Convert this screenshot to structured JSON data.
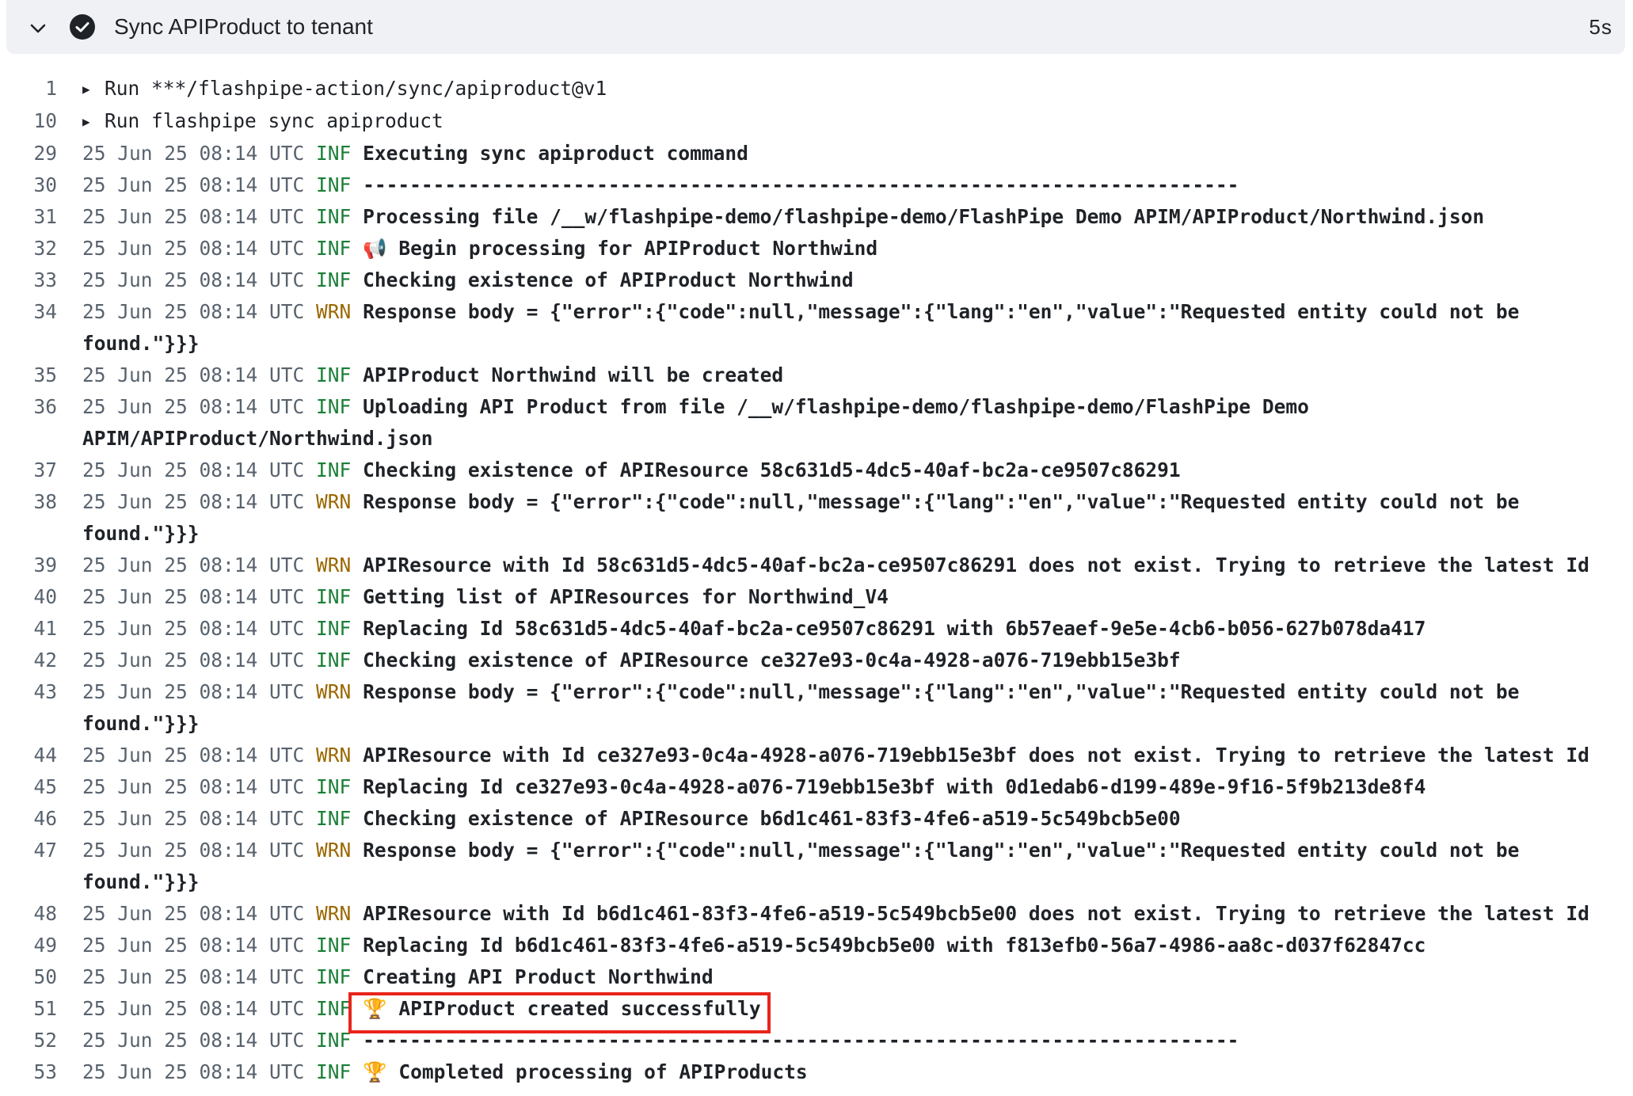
{
  "header": {
    "title": "Sync APIProduct to tenant",
    "duration": "5s",
    "expand_icon": "chevron-down-icon",
    "status_icon": "check-circle-icon"
  },
  "log_lines": [
    {
      "num": "1",
      "type": "run",
      "text": "Run ***/flashpipe-action/sync/apiproduct@v1"
    },
    {
      "num": "10",
      "type": "run",
      "text": "Run flashpipe sync apiproduct"
    },
    {
      "num": "29",
      "ts": "25 Jun 25 08:14 UTC",
      "level": "INF",
      "msg": "Executing sync apiproduct command"
    },
    {
      "num": "30",
      "ts": "25 Jun 25 08:14 UTC",
      "level": "INF",
      "msg": "---------------------------------------------------------------------------"
    },
    {
      "num": "31",
      "ts": "25 Jun 25 08:14 UTC",
      "level": "INF",
      "msg": "Processing file /__w/flashpipe-demo/flashpipe-demo/FlashPipe Demo APIM/APIProduct/Northwind.json"
    },
    {
      "num": "32",
      "ts": "25 Jun 25 08:14 UTC",
      "level": "INF",
      "msg": "📢 Begin processing for APIProduct Northwind"
    },
    {
      "num": "33",
      "ts": "25 Jun 25 08:14 UTC",
      "level": "INF",
      "msg": "Checking existence of APIProduct Northwind"
    },
    {
      "num": "34",
      "ts": "25 Jun 25 08:14 UTC",
      "level": "WRN",
      "msg": "Response body = {\"error\":{\"code\":null,\"message\":{\"lang\":\"en\",\"value\":\"Requested entity could not be found.\"}}}"
    },
    {
      "num": "35",
      "ts": "25 Jun 25 08:14 UTC",
      "level": "INF",
      "msg": "APIProduct Northwind will be created"
    },
    {
      "num": "36",
      "ts": "25 Jun 25 08:14 UTC",
      "level": "INF",
      "msg": "Uploading API Product from file /__w/flashpipe-demo/flashpipe-demo/FlashPipe Demo APIM/APIProduct/Northwind.json"
    },
    {
      "num": "37",
      "ts": "25 Jun 25 08:14 UTC",
      "level": "INF",
      "msg": "Checking existence of APIResource 58c631d5-4dc5-40af-bc2a-ce9507c86291"
    },
    {
      "num": "38",
      "ts": "25 Jun 25 08:14 UTC",
      "level": "WRN",
      "msg": "Response body = {\"error\":{\"code\":null,\"message\":{\"lang\":\"en\",\"value\":\"Requested entity could not be found.\"}}}"
    },
    {
      "num": "39",
      "ts": "25 Jun 25 08:14 UTC",
      "level": "WRN",
      "msg": "APIResource with Id 58c631d5-4dc5-40af-bc2a-ce9507c86291 does not exist. Trying to retrieve the latest Id"
    },
    {
      "num": "40",
      "ts": "25 Jun 25 08:14 UTC",
      "level": "INF",
      "msg": "Getting list of APIResources for Northwind_V4"
    },
    {
      "num": "41",
      "ts": "25 Jun 25 08:14 UTC",
      "level": "INF",
      "msg": "Replacing Id 58c631d5-4dc5-40af-bc2a-ce9507c86291 with 6b57eaef-9e5e-4cb6-b056-627b078da417"
    },
    {
      "num": "42",
      "ts": "25 Jun 25 08:14 UTC",
      "level": "INF",
      "msg": "Checking existence of APIResource ce327e93-0c4a-4928-a076-719ebb15e3bf"
    },
    {
      "num": "43",
      "ts": "25 Jun 25 08:14 UTC",
      "level": "WRN",
      "msg": "Response body = {\"error\":{\"code\":null,\"message\":{\"lang\":\"en\",\"value\":\"Requested entity could not be found.\"}}}"
    },
    {
      "num": "44",
      "ts": "25 Jun 25 08:14 UTC",
      "level": "WRN",
      "msg": "APIResource with Id ce327e93-0c4a-4928-a076-719ebb15e3bf does not exist. Trying to retrieve the latest Id"
    },
    {
      "num": "45",
      "ts": "25 Jun 25 08:14 UTC",
      "level": "INF",
      "msg": "Replacing Id ce327e93-0c4a-4928-a076-719ebb15e3bf with 0d1edab6-d199-489e-9f16-5f9b213de8f4"
    },
    {
      "num": "46",
      "ts": "25 Jun 25 08:14 UTC",
      "level": "INF",
      "msg": "Checking existence of APIResource b6d1c461-83f3-4fe6-a519-5c549bcb5e00"
    },
    {
      "num": "47",
      "ts": "25 Jun 25 08:14 UTC",
      "level": "WRN",
      "msg": "Response body = {\"error\":{\"code\":null,\"message\":{\"lang\":\"en\",\"value\":\"Requested entity could not be found.\"}}}"
    },
    {
      "num": "48",
      "ts": "25 Jun 25 08:14 UTC",
      "level": "WRN",
      "msg": "APIResource with Id b6d1c461-83f3-4fe6-a519-5c549bcb5e00 does not exist. Trying to retrieve the latest Id"
    },
    {
      "num": "49",
      "ts": "25 Jun 25 08:14 UTC",
      "level": "INF",
      "msg": "Replacing Id b6d1c461-83f3-4fe6-a519-5c549bcb5e00 with f813efb0-56a7-4986-aa8c-d037f62847cc"
    },
    {
      "num": "50",
      "ts": "25 Jun 25 08:14 UTC",
      "level": "INF",
      "msg": "Creating API Product Northwind"
    },
    {
      "num": "51",
      "ts": "25 Jun 25 08:14 UTC",
      "level": "INF",
      "msg": "🏆 APIProduct created successfully",
      "highlighted": true
    },
    {
      "num": "52",
      "ts": "25 Jun 25 08:14 UTC",
      "level": "INF",
      "msg": "---------------------------------------------------------------------------"
    },
    {
      "num": "53",
      "ts": "25 Jun 25 08:14 UTC",
      "level": "INF",
      "msg": "🏆 Completed processing of APIProducts"
    }
  ],
  "colors": {
    "header_bg": "#f0f1f4",
    "info_level": "#1a7f37",
    "warn_level": "#9a6700",
    "highlight_border": "#e8241a"
  }
}
